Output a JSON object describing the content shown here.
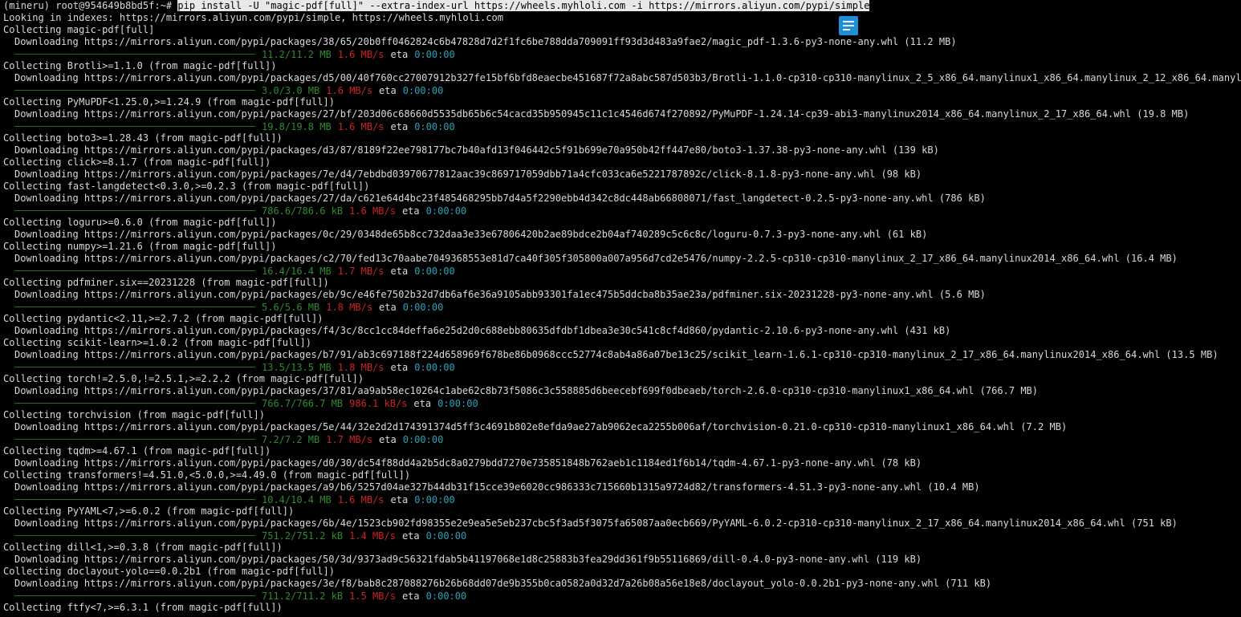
{
  "prompt": "(mineru) root@954649b8bd5f:~# ",
  "command": "pip install -U \"magic-pdf[full]\" --extra-index-url https://wheels.myhloli.com -i https://mirrors.aliyun.com/pypi/simple",
  "eta_label": "eta",
  "lines": [
    {
      "type": "text",
      "indent": false,
      "text": "Looking in indexes: https://mirrors.aliyun.com/pypi/simple, https://wheels.myhloli.com"
    },
    {
      "type": "text",
      "indent": false,
      "text": "Collecting magic-pdf[full]"
    },
    {
      "type": "text",
      "indent": true,
      "text": "Downloading https://mirrors.aliyun.com/pypi/packages/38/65/20b0ff0462824c6b47828d7d2f1fc6be788dda709091ff93d3d483a9fae2/magic_pdf-1.3.6-py3-none-any.whl (11.2 MB)"
    },
    {
      "type": "progress",
      "size": "11.2/11.2 MB",
      "rate": "1.6 MB/s",
      "eta": "0:00:00"
    },
    {
      "type": "text",
      "indent": false,
      "text": "Collecting Brotli>=1.1.0 (from magic-pdf[full])"
    },
    {
      "type": "text",
      "indent": true,
      "text": "Downloading https://mirrors.aliyun.com/pypi/packages/d5/00/40f760cc27007912b327fe15bf6bfd8eaecbe451687f72a8abc587d503b3/Brotli-1.1.0-cp310-cp310-manylinux_2_5_x86_64.manylinux1_x86_64.manylinux_2_12_x86_64.manylinux2010"
    },
    {
      "type": "progress",
      "size": "3.0/3.0 MB",
      "rate": "1.6 MB/s",
      "eta": "0:00:00"
    },
    {
      "type": "text",
      "indent": false,
      "text": "Collecting PyMuPDF<1.25.0,>=1.24.9 (from magic-pdf[full])"
    },
    {
      "type": "text",
      "indent": true,
      "text": "Downloading https://mirrors.aliyun.com/pypi/packages/27/bf/203d06c68660d5535db65b6c54cacd35b950945c11c1c4546d674f270892/PyMuPDF-1.24.14-cp39-abi3-manylinux2014_x86_64.manylinux_2_17_x86_64.whl (19.8 MB)"
    },
    {
      "type": "progress",
      "size": "19.8/19.8 MB",
      "rate": "1.6 MB/s",
      "eta": "0:00:00"
    },
    {
      "type": "text",
      "indent": false,
      "text": "Collecting boto3>=1.28.43 (from magic-pdf[full])"
    },
    {
      "type": "text",
      "indent": true,
      "text": "Downloading https://mirrors.aliyun.com/pypi/packages/d3/87/8189f22ee798177bc7b40afd13f046442c5f91b699e70a950b42ff447e80/boto3-1.37.38-py3-none-any.whl (139 kB)"
    },
    {
      "type": "text",
      "indent": false,
      "text": "Collecting click>=8.1.7 (from magic-pdf[full])"
    },
    {
      "type": "text",
      "indent": true,
      "text": "Downloading https://mirrors.aliyun.com/pypi/packages/7e/d4/7ebdbd03970677812aac39c869717059dbb71a4cfc033ca6e5221787892c/click-8.1.8-py3-none-any.whl (98 kB)"
    },
    {
      "type": "text",
      "indent": false,
      "text": "Collecting fast-langdetect<0.3.0,>=0.2.3 (from magic-pdf[full])"
    },
    {
      "type": "text",
      "indent": true,
      "text": "Downloading https://mirrors.aliyun.com/pypi/packages/27/da/c621e64d4bc23f485468295bb7d4a5f2290ebb4d342c8dc448ab66808071/fast_langdetect-0.2.5-py3-none-any.whl (786 kB)"
    },
    {
      "type": "progress",
      "size": "786.6/786.6 kB",
      "rate": "1.6 MB/s",
      "eta": "0:00:00"
    },
    {
      "type": "text",
      "indent": false,
      "text": "Collecting loguru>=0.6.0 (from magic-pdf[full])"
    },
    {
      "type": "text",
      "indent": true,
      "text": "Downloading https://mirrors.aliyun.com/pypi/packages/0c/29/0348de65b8cc732daa3e33e67806420b2ae89bdce2b04af740289c5c6c8c/loguru-0.7.3-py3-none-any.whl (61 kB)"
    },
    {
      "type": "text",
      "indent": false,
      "text": "Collecting numpy>=1.21.6 (from magic-pdf[full])"
    },
    {
      "type": "text",
      "indent": true,
      "text": "Downloading https://mirrors.aliyun.com/pypi/packages/c2/70/fed13c70aabe7049368553e81d7ca40f305f305800a007a956d7cd2e5476/numpy-2.2.5-cp310-cp310-manylinux_2_17_x86_64.manylinux2014_x86_64.whl (16.4 MB)"
    },
    {
      "type": "progress",
      "size": "16.4/16.4 MB",
      "rate": "1.7 MB/s",
      "eta": "0:00:00"
    },
    {
      "type": "text",
      "indent": false,
      "text": "Collecting pdfminer.six==20231228 (from magic-pdf[full])"
    },
    {
      "type": "text",
      "indent": true,
      "text": "Downloading https://mirrors.aliyun.com/pypi/packages/eb/9c/e46fe7502b32d7db6af6e36a9105abb93301fa1ec475b5ddcba8b35ae23a/pdfminer.six-20231228-py3-none-any.whl (5.6 MB)"
    },
    {
      "type": "progress",
      "size": "5.6/5.6 MB",
      "rate": "1.8 MB/s",
      "eta": "0:00:00"
    },
    {
      "type": "text",
      "indent": false,
      "text": "Collecting pydantic<2.11,>=2.7.2 (from magic-pdf[full])"
    },
    {
      "type": "text",
      "indent": true,
      "text": "Downloading https://mirrors.aliyun.com/pypi/packages/f4/3c/8cc1cc84deffa6e25d2d0c688ebb80635dfdbf1dbea3e30c541c8cf4d860/pydantic-2.10.6-py3-none-any.whl (431 kB)"
    },
    {
      "type": "text",
      "indent": false,
      "text": "Collecting scikit-learn>=1.0.2 (from magic-pdf[full])"
    },
    {
      "type": "text",
      "indent": true,
      "text": "Downloading https://mirrors.aliyun.com/pypi/packages/b7/91/ab3c697188f224d658969f678be86b0968ccc52774c8ab4a86a07be13c25/scikit_learn-1.6.1-cp310-cp310-manylinux_2_17_x86_64.manylinux2014_x86_64.whl (13.5 MB)"
    },
    {
      "type": "progress",
      "size": "13.5/13.5 MB",
      "rate": "1.8 MB/s",
      "eta": "0:00:00"
    },
    {
      "type": "text",
      "indent": false,
      "text": "Collecting torch!=2.5.0,!=2.5.1,>=2.2.2 (from magic-pdf[full])"
    },
    {
      "type": "text",
      "indent": true,
      "text": "Downloading https://mirrors.aliyun.com/pypi/packages/37/81/aa9ab58ec10264c1abe62c8b73f5086c3c558885d6beecebf699f0dbeaeb/torch-2.6.0-cp310-cp310-manylinux1_x86_64.whl (766.7 MB)"
    },
    {
      "type": "progress",
      "size": "766.7/766.7 MB",
      "rate": "986.1 kB/s",
      "eta": "0:00:00"
    },
    {
      "type": "text",
      "indent": false,
      "text": "Collecting torchvision (from magic-pdf[full])"
    },
    {
      "type": "text",
      "indent": true,
      "text": "Downloading https://mirrors.aliyun.com/pypi/packages/5e/44/32e2d2d174391374d5ff3c4691b802e8efda9ae27ab9062eca2255b006af/torchvision-0.21.0-cp310-cp310-manylinux1_x86_64.whl (7.2 MB)"
    },
    {
      "type": "progress",
      "size": "7.2/7.2 MB",
      "rate": "1.7 MB/s",
      "eta": "0:00:00"
    },
    {
      "type": "text",
      "indent": false,
      "text": "Collecting tqdm>=4.67.1 (from magic-pdf[full])"
    },
    {
      "type": "text",
      "indent": true,
      "text": "Downloading https://mirrors.aliyun.com/pypi/packages/d0/30/dc54f88dd4a2b5dc8a0279bdd7270e735851848b762aeb1c1184ed1f6b14/tqdm-4.67.1-py3-none-any.whl (78 kB)"
    },
    {
      "type": "text",
      "indent": false,
      "text": "Collecting transformers!=4.51.0,<5.0.0,>=4.49.0 (from magic-pdf[full])"
    },
    {
      "type": "text",
      "indent": true,
      "text": "Downloading https://mirrors.aliyun.com/pypi/packages/a9/b6/5257d04ae327b44db31f15cce39e6020cc986333c715660b1315a9724d82/transformers-4.51.3-py3-none-any.whl (10.4 MB)"
    },
    {
      "type": "progress",
      "size": "10.4/10.4 MB",
      "rate": "1.6 MB/s",
      "eta": "0:00:00"
    },
    {
      "type": "text",
      "indent": false,
      "text": "Collecting PyYAML<7,>=6.0.2 (from magic-pdf[full])"
    },
    {
      "type": "text",
      "indent": true,
      "text": "Downloading https://mirrors.aliyun.com/pypi/packages/6b/4e/1523cb902fd98355e2e9ea5e5eb237cbc5f3ad5f3075fa65087aa0ecb669/PyYAML-6.0.2-cp310-cp310-manylinux_2_17_x86_64.manylinux2014_x86_64.whl (751 kB)"
    },
    {
      "type": "progress",
      "size": "751.2/751.2 kB",
      "rate": "1.4 MB/s",
      "eta": "0:00:00"
    },
    {
      "type": "text",
      "indent": false,
      "text": "Collecting dill<1,>=0.3.8 (from magic-pdf[full])"
    },
    {
      "type": "text",
      "indent": true,
      "text": "Downloading https://mirrors.aliyun.com/pypi/packages/50/3d/9373ad9c56321fdab5b41197068e1d8c25883b3fea29dd361f9b55116869/dill-0.4.0-py3-none-any.whl (119 kB)"
    },
    {
      "type": "text",
      "indent": false,
      "text": "Collecting doclayout-yolo==0.0.2b1 (from magic-pdf[full])"
    },
    {
      "type": "text",
      "indent": true,
      "text": "Downloading https://mirrors.aliyun.com/pypi/packages/3e/f8/bab8c287088276b26b68dd07de9b355b0ca0582a0d32d7a26b08a56e18e8/doclayout_yolo-0.0.2b1-py3-none-any.whl (711 kB)"
    },
    {
      "type": "progress",
      "size": "711.2/711.2 kB",
      "rate": "1.5 MB/s",
      "eta": "0:00:00"
    },
    {
      "type": "text",
      "indent": false,
      "text": "Collecting ftfy<7,>=6.3.1 (from magic-pdf[full])"
    }
  ]
}
